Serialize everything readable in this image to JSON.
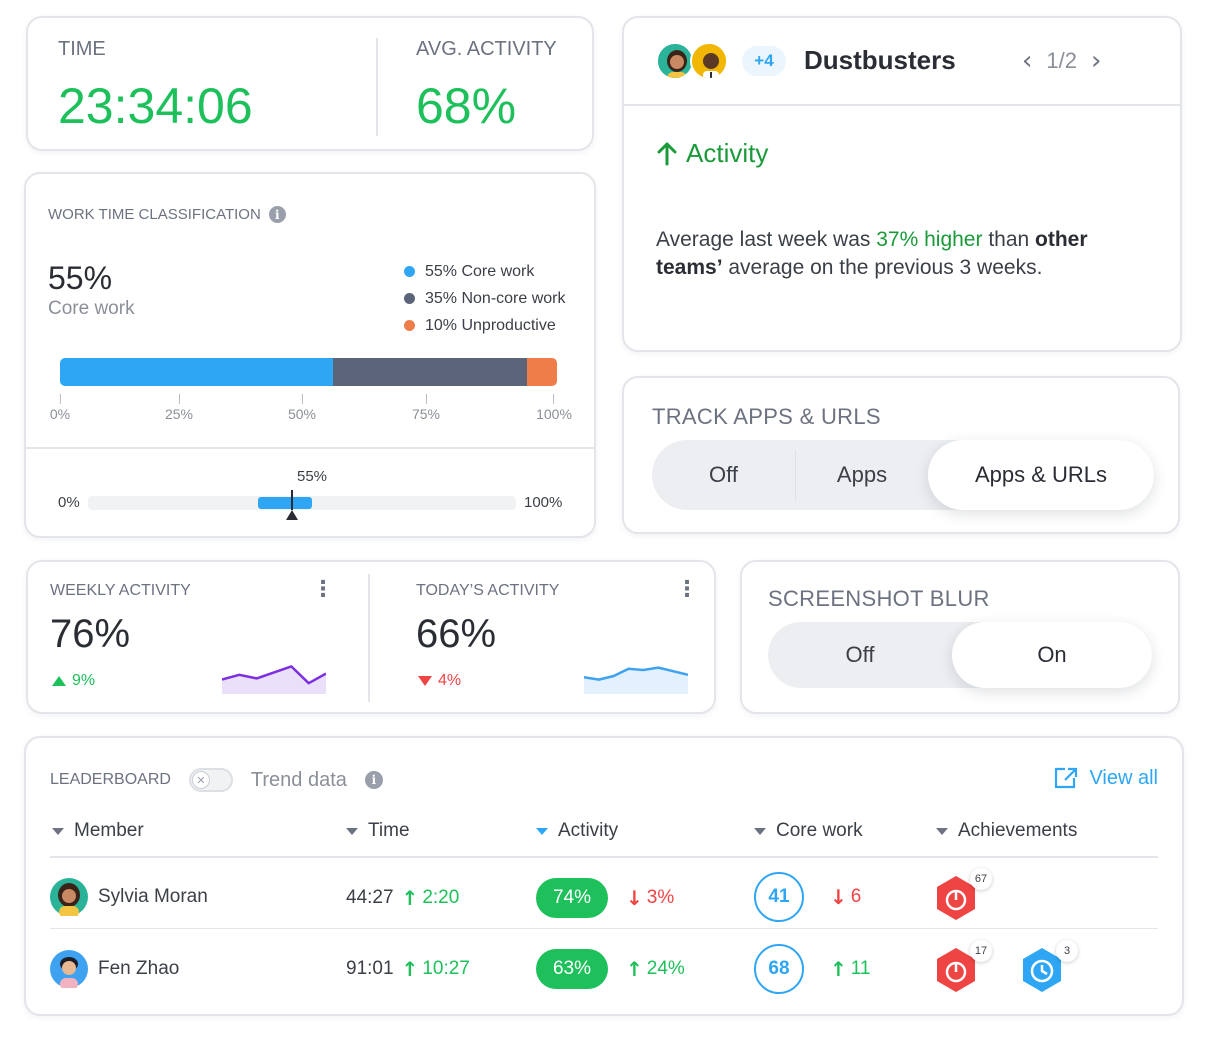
{
  "time_card": {
    "time_label": "TIME",
    "time_value": "23:34:06",
    "avg_label": "AVG. ACTIVITY",
    "avg_value": "68%"
  },
  "work_time": {
    "title": "WORK TIME CLASSIFICATION",
    "info_icon": "i",
    "headline_pct": "55%",
    "headline_sub": "Core work",
    "legend": [
      {
        "label": "55% Core work",
        "color": "#2ea6f3"
      },
      {
        "label": "35% Non-core work",
        "color": "#5b6478"
      },
      {
        "label": "10% Unproductive",
        "color": "#ee7d4a"
      }
    ],
    "segments": [
      {
        "name": "Core work",
        "value": 55,
        "color": "#2ea6f3"
      },
      {
        "name": "Non-core work",
        "value": 39,
        "color": "#5b6478"
      },
      {
        "name": "Unproductive",
        "value": 6,
        "color": "#ee7d4a"
      }
    ],
    "ticks": [
      "0%",
      "25%",
      "50%",
      "75%",
      "100%"
    ],
    "mini_value_label": "55%",
    "mini_value": 55,
    "mini_min": "0%",
    "mini_max": "100%"
  },
  "team_card": {
    "plus_count": "+4",
    "team_name": "Dustbusters",
    "pager": "1/2",
    "prev_icon": "‹",
    "next_icon": "›",
    "metric": "Activity",
    "msg_part1": "Average last week was ",
    "msg_highlight": "37% higher",
    "msg_part2": " than ",
    "msg_bold": "other teams’",
    "msg_part3": " average on the previous 3 weeks."
  },
  "track_apps": {
    "label": "TRACK APPS & URLS",
    "options": [
      "Off",
      "Apps",
      "Apps & URLs"
    ],
    "selected": "Apps & URLs"
  },
  "weekly": {
    "label": "WEEKLY ACTIVITY",
    "value": "76%",
    "delta": "9%",
    "delta_dir": "up",
    "spark": [
      0.35,
      0.55,
      0.4,
      0.65,
      0.9,
      0.2,
      0.6
    ],
    "spark_color": "#7b2fe0"
  },
  "today": {
    "label": "TODAY’S ACTIVITY",
    "value": "66%",
    "delta": "4%",
    "delta_dir": "down",
    "spark": [
      0.45,
      0.35,
      0.5,
      0.8,
      0.75,
      0.85,
      0.7,
      0.55
    ],
    "spark_color": "#3fa2f0"
  },
  "blur": {
    "label": "SCREENSHOT BLUR",
    "options": [
      "Off",
      "On"
    ],
    "selected": "On"
  },
  "leaderboard": {
    "title": "LEADERBOARD",
    "trend_label": "Trend data",
    "view_all": "View all",
    "columns": [
      "Member",
      "Time",
      "Activity",
      "Core work",
      "Achievements"
    ],
    "sorted_column": "Activity",
    "rows": [
      {
        "name": "Sylvia Moran",
        "time": "44:27",
        "time_delta": "2:20",
        "time_dir": "up",
        "activity": "74%",
        "activity_delta": "3%",
        "activity_dir": "down",
        "core": "41",
        "core_delta": "6",
        "core_dir": "down",
        "badges": [
          {
            "count": "67",
            "color": "#ef4444",
            "icon": "fire-icon"
          }
        ]
      },
      {
        "name": "Fen Zhao",
        "time": "91:01",
        "time_delta": "10:27",
        "time_dir": "up",
        "activity": "63%",
        "activity_delta": "24%",
        "activity_dir": "up",
        "core": "68",
        "core_delta": "11",
        "core_dir": "up",
        "badges": [
          {
            "count": "17",
            "color": "#ef4444",
            "icon": "fire-icon"
          },
          {
            "count": "3",
            "color": "#2ea6f3",
            "icon": "clock-icon"
          }
        ]
      }
    ]
  }
}
